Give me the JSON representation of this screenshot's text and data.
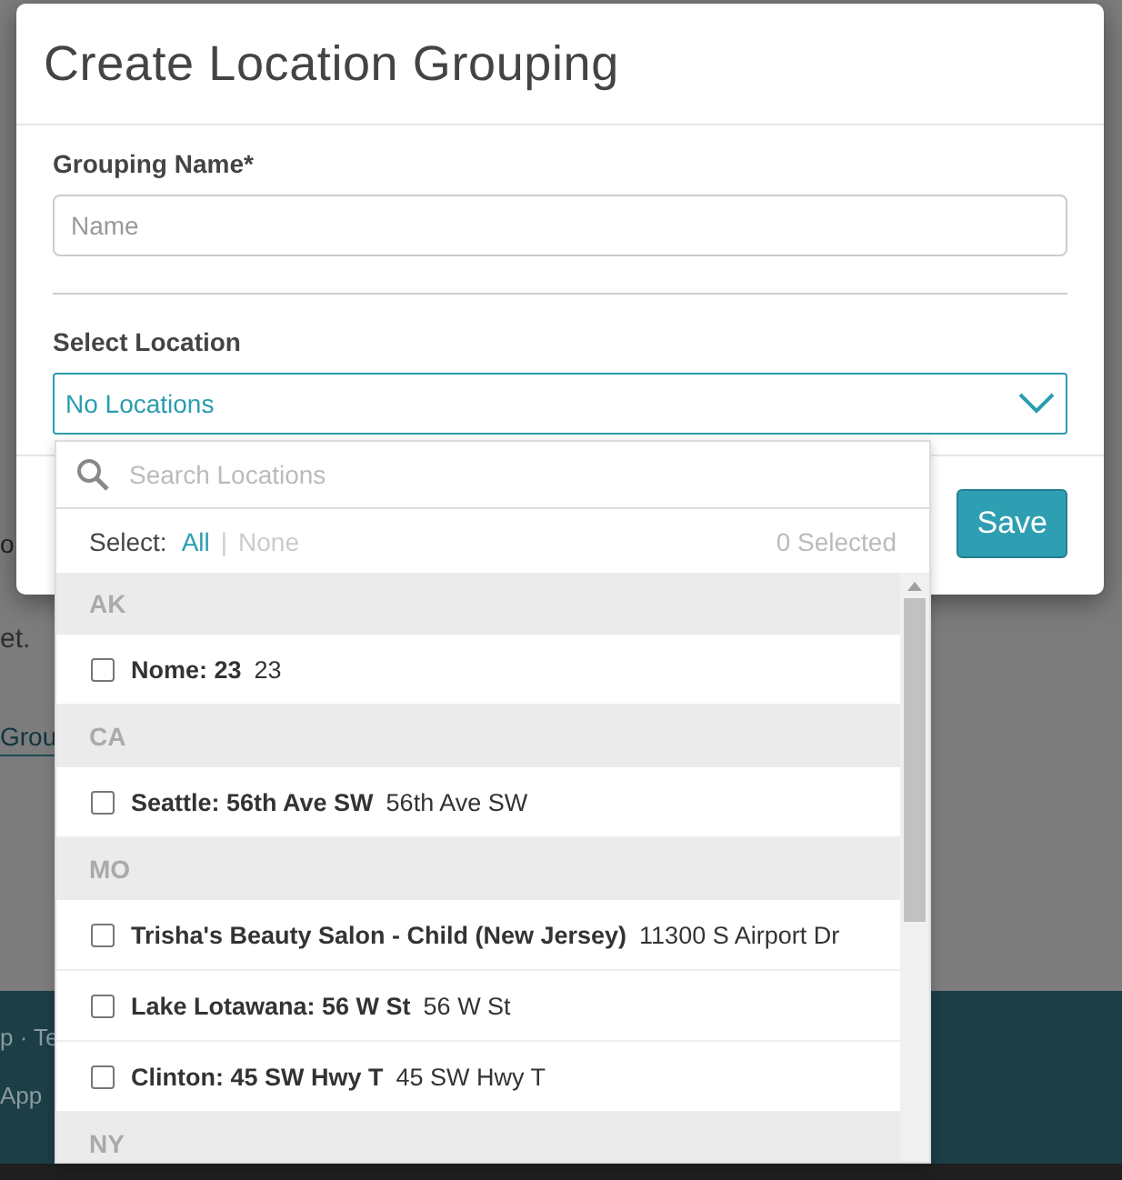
{
  "background": {
    "fragments": [
      "o",
      "et.",
      "Grou",
      "p · Te",
      "App"
    ]
  },
  "modal": {
    "title": "Create Location Grouping",
    "name_label": "Grouping Name*",
    "name_placeholder": "Name",
    "location_label": "Select Location",
    "location_value": "No Locations",
    "save_button": "Save"
  },
  "dropdown": {
    "search_placeholder": "Search Locations",
    "select_label": "Select:",
    "select_all": "All",
    "separator": "|",
    "select_none": "None",
    "selected_count": "0 Selected",
    "groups": [
      {
        "state": "AK",
        "locations": [
          {
            "name": "Nome: 23",
            "address": "23",
            "checked": false
          }
        ]
      },
      {
        "state": "CA",
        "locations": [
          {
            "name": "Seattle: 56th Ave SW",
            "address": "56th Ave SW",
            "checked": false
          }
        ]
      },
      {
        "state": "MO",
        "locations": [
          {
            "name": "Trisha's Beauty Salon - Child (New Jersey)",
            "address": "11300 S Airport Dr",
            "checked": false
          },
          {
            "name": "Lake Lotawana: 56 W St",
            "address": "56 W St",
            "checked": false
          },
          {
            "name": "Clinton: 45 SW Hwy T",
            "address": "45 SW Hwy T",
            "checked": false
          }
        ]
      },
      {
        "state": "NY"
      }
    ]
  }
}
